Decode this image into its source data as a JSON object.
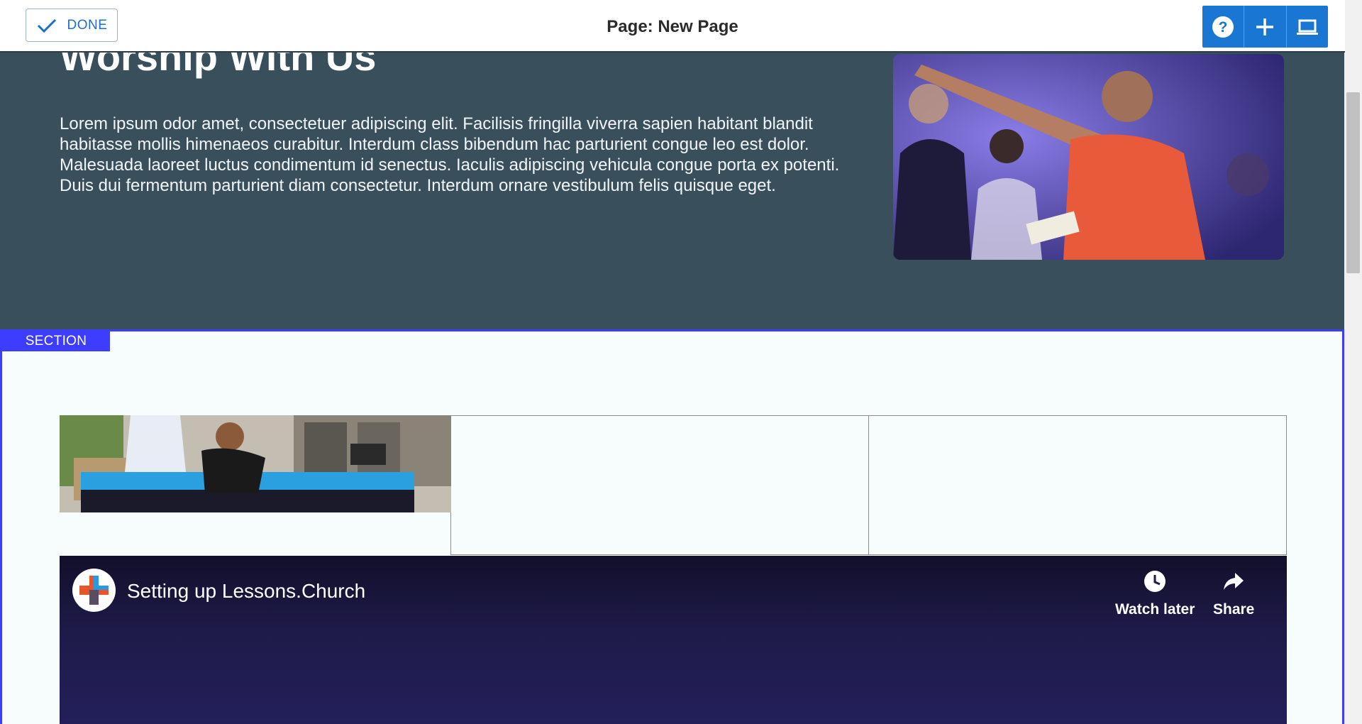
{
  "toolbar": {
    "done_label": "DONE",
    "page_title": "Page: New Page",
    "icons": [
      "help-icon",
      "add-icon",
      "laptop-icon"
    ],
    "accent_color": "#1976d2"
  },
  "hero": {
    "heading": "Worship With Us",
    "body": "Lorem ipsum odor amet, consectetuer adipiscing elit. Facilisis fringilla viverra sapien habitant blandit habitasse mollis himenaeos curabitur. Interdum class bibendum hac parturient congue leo est dolor. Malesuada laoreet luctus condimentum id senectus. Iaculis adipiscing vehicula congue porta ex potenti. Duis dui fermentum parturient diam consectetur. Interdum ornare vestibulum felis quisque eget.",
    "background_color": "#3a4f5c"
  },
  "section": {
    "label": "SECTION",
    "border_color": "#3d3dff"
  },
  "video": {
    "title": "Setting up Lessons.Church",
    "watch_later_label": "Watch later",
    "share_label": "Share"
  }
}
